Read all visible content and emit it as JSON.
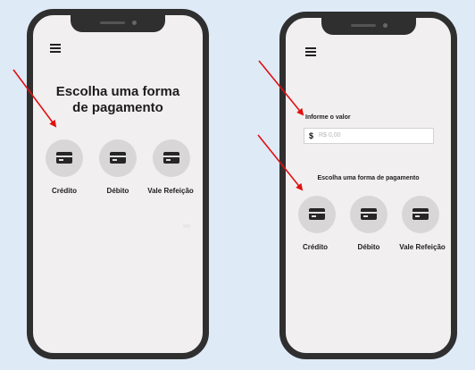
{
  "left_screen": {
    "title_line1": "Escolha uma forma",
    "title_line2": "de pagamento",
    "options": [
      {
        "label": "Crédito",
        "icon": "credit-card-icon"
      },
      {
        "label": "Débito",
        "icon": "credit-card-icon"
      },
      {
        "label": "Vale Refeição",
        "icon": "credit-card-icon"
      }
    ]
  },
  "right_screen": {
    "value_label": "Informe o valor",
    "currency_symbol": "$",
    "value_placeholder": "R$ 0,00",
    "section_label": "Escolha uma forma de pagamento",
    "options": [
      {
        "label": "Crédito",
        "icon": "credit-card-icon"
      },
      {
        "label": "Débito",
        "icon": "credit-card-icon"
      },
      {
        "label": "Vale Refeição",
        "icon": "credit-card-icon"
      }
    ]
  },
  "colors": {
    "background": "#dfeaf7",
    "phone_frame": "#2f2f2f",
    "screen": "#f2eff0",
    "option_circle": "#d9d6d7",
    "annotation_arrow": "#e01010"
  }
}
